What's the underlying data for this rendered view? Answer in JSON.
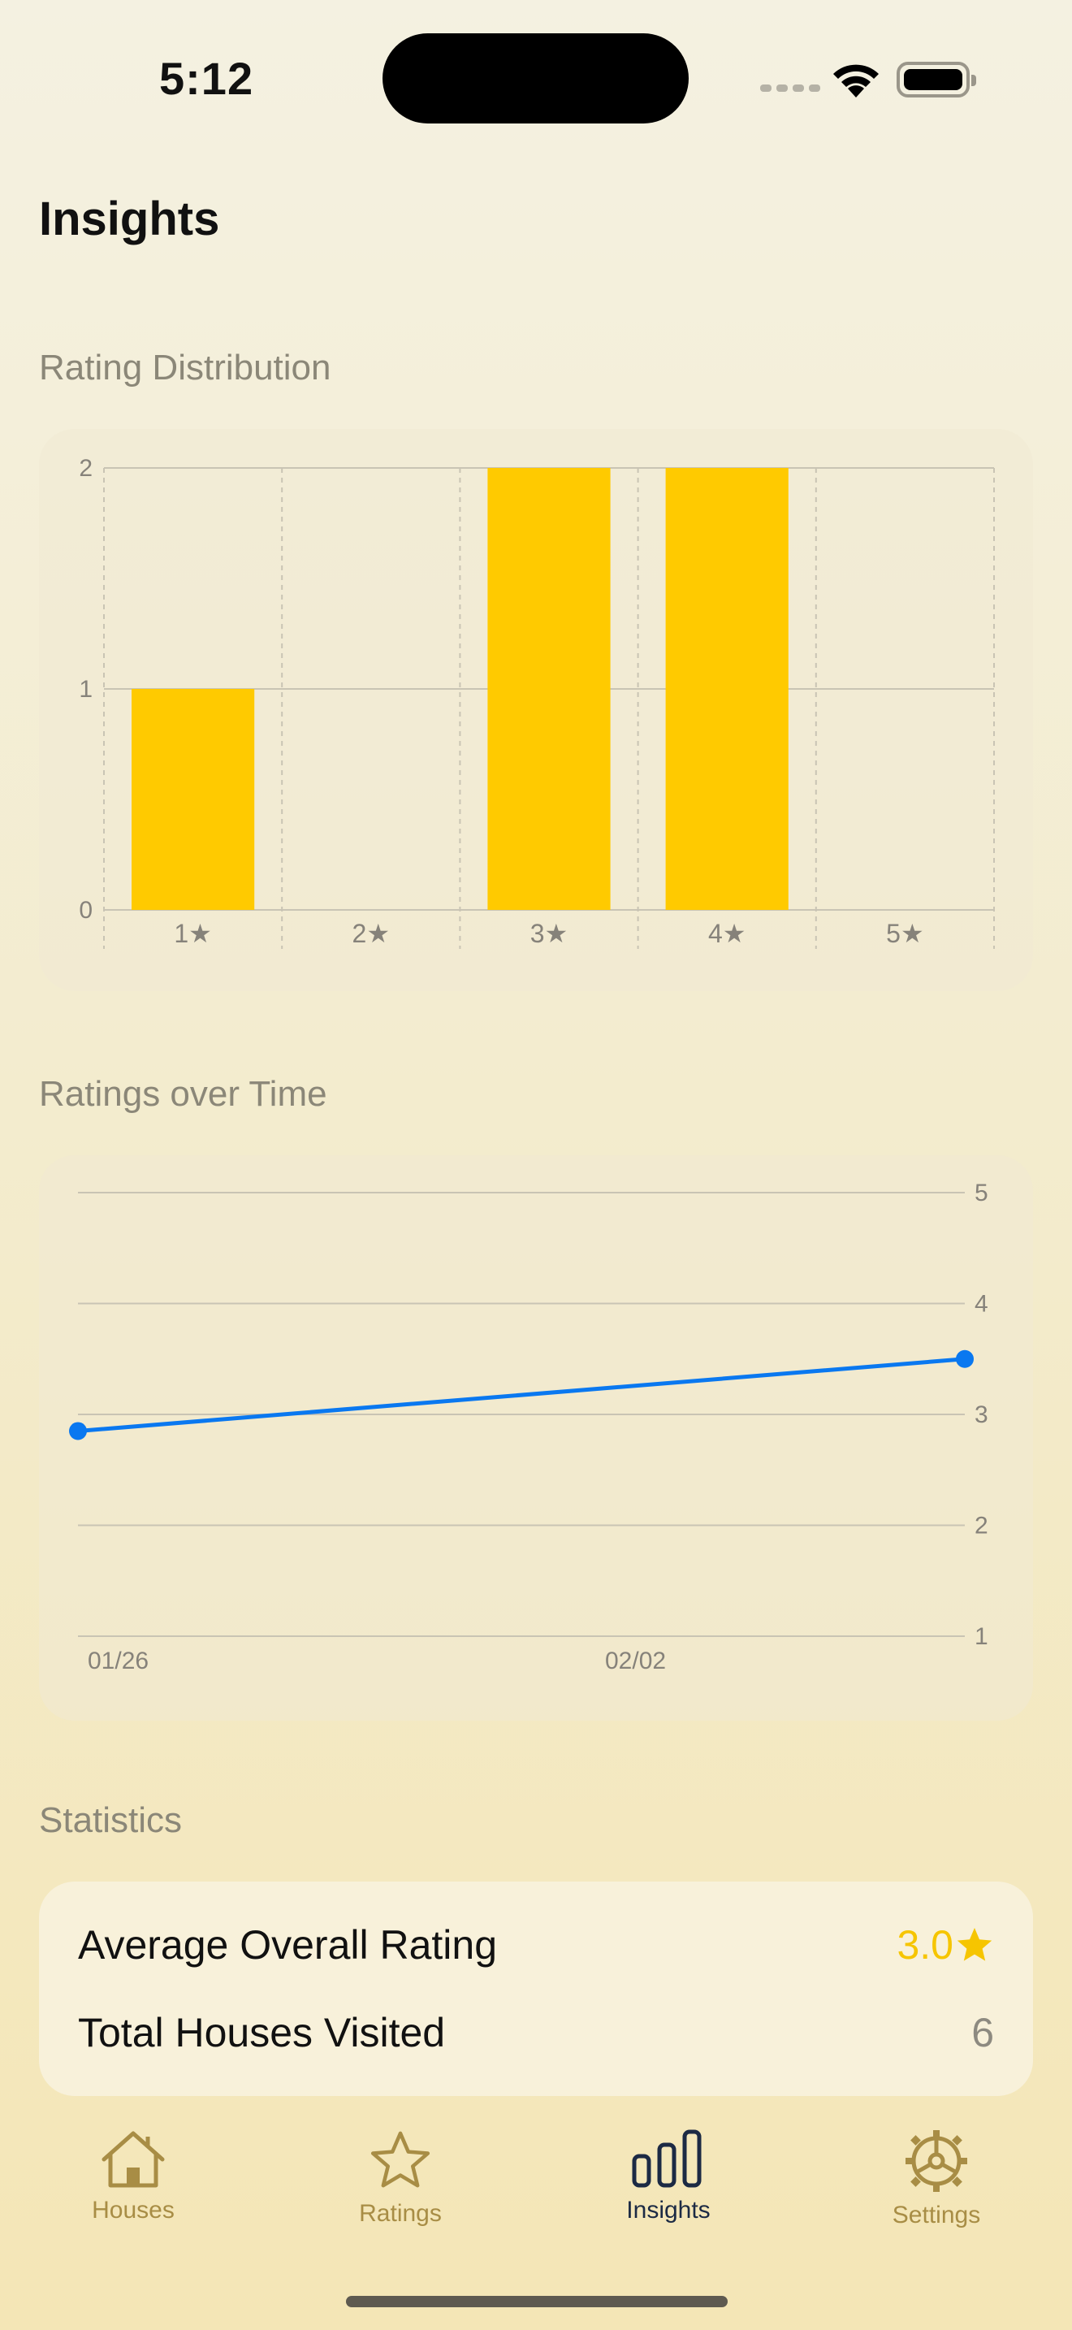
{
  "status_bar": {
    "time": "5:12"
  },
  "page": {
    "title": "Insights"
  },
  "sections": {
    "distribution_header": "Rating Distribution",
    "time_header": "Ratings over Time",
    "statistics_header": "Statistics"
  },
  "chart_data": [
    {
      "type": "bar",
      "title": "Rating Distribution",
      "categories": [
        "1★",
        "2★",
        "3★",
        "4★",
        "5★"
      ],
      "values": [
        1,
        0,
        2,
        2,
        0
      ],
      "ylim": [
        0,
        2
      ],
      "yticks": [
        "0",
        "1",
        "2"
      ],
      "grid": true,
      "color": "#FFCA00"
    },
    {
      "type": "line",
      "title": "Ratings over Time",
      "x": [
        "01/26",
        "02/02"
      ],
      "x_tick_labels": [
        "01/26",
        "02/02"
      ],
      "points": [
        {
          "x": "01/26",
          "y": 2.85
        },
        {
          "x": "02/07",
          "y": 3.5
        }
      ],
      "ylim": [
        1,
        5
      ],
      "yticks": [
        "1",
        "2",
        "3",
        "4",
        "5"
      ],
      "grid": true,
      "color": "#0A78F0"
    }
  ],
  "statistics": {
    "average_label": "Average Overall Rating",
    "average_value": "3.0",
    "total_label": "Total Houses Visited",
    "total_value": "6"
  },
  "tabs": [
    {
      "label": "Houses",
      "icon": "house-icon",
      "active": false
    },
    {
      "label": "Ratings",
      "icon": "star-icon",
      "active": false
    },
    {
      "label": "Insights",
      "icon": "bar-chart-icon",
      "active": true
    },
    {
      "label": "Settings",
      "icon": "gear-icon",
      "active": false
    }
  ],
  "colors": {
    "accent": "#FFCA00",
    "line": "#0A78F0",
    "tab_inactive": "#A88D45",
    "tab_active": "#1C2A44"
  }
}
